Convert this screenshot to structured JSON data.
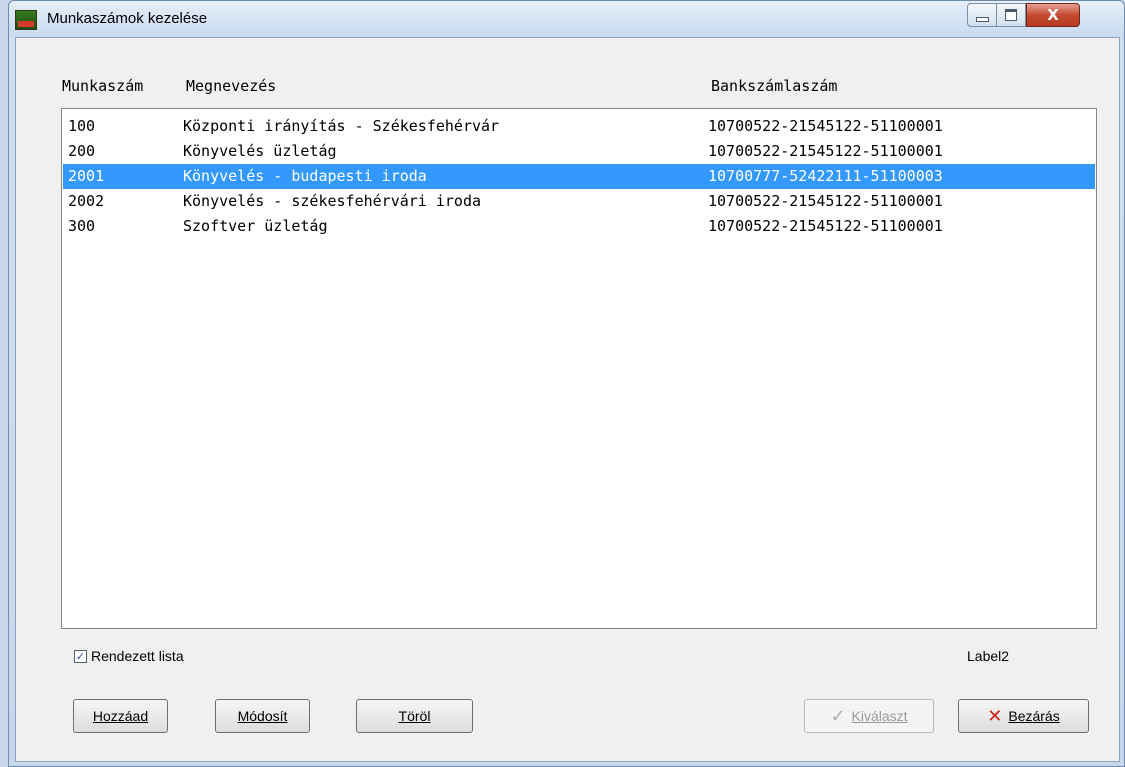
{
  "window": {
    "title": "Munkaszámok kezelése",
    "close_glyph": "X"
  },
  "columns": {
    "munkaszam": "Munkaszám",
    "megnevezes": "Megnevezés",
    "bankszamlaszam": "Bankszámlaszám"
  },
  "rows": [
    {
      "munkaszam": "100",
      "megnevezes": "Központi irányítás - Székesfehérvár",
      "bankszamla": "10700522-21545122-51100001"
    },
    {
      "munkaszam": "200",
      "megnevezes": "Könyvelés üzletág",
      "bankszamla": "10700522-21545122-51100001"
    },
    {
      "munkaszam": "2001",
      "megnevezes": "Könyvelés - budapesti iroda",
      "bankszamla": "10700777-52422111-51100003"
    },
    {
      "munkaszam": "2002",
      "megnevezes": "Könyvelés - székesfehérvári iroda",
      "bankszamla": "10700522-21545122-51100001"
    },
    {
      "munkaszam": "300",
      "megnevezes": "Szoftver üzletág",
      "bankszamla": "10700522-21545122-51100001"
    }
  ],
  "selected_row": "2001",
  "sorted_list": {
    "label": "Rendezett lista",
    "checked": true
  },
  "status_label": "Label2",
  "buttons": {
    "add": "Hozzáad",
    "modify": "Módosít",
    "delete": "Töröl",
    "select": "Kiválaszt",
    "close": "Bezárás"
  },
  "colors": {
    "selection": "#3399ff",
    "close_button": "#c44a32"
  },
  "icons": {
    "app": "app-icon",
    "select": "checkmark-icon",
    "close": "red-x-icon"
  }
}
